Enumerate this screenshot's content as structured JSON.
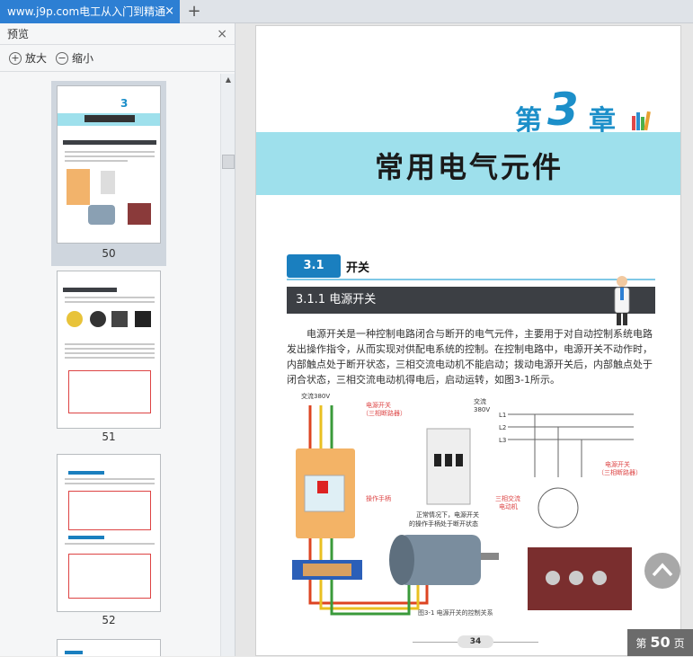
{
  "tab": {
    "title": "www.j9p.com电工从入门到精通",
    "new_tab": "+",
    "close": "×"
  },
  "sidebar": {
    "title": "预览",
    "close": "×",
    "zoom_in": "放大",
    "zoom_out": "缩小",
    "thumbnails": [
      {
        "page": "50",
        "selected": true
      },
      {
        "page": "51",
        "selected": false
      },
      {
        "page": "52",
        "selected": false
      }
    ]
  },
  "page": {
    "chapter_prefix": "第",
    "chapter_number": "3",
    "chapter_suffix": "章",
    "chapter_title": "常用电气元件",
    "section_number": "3.1",
    "section_title": "开关",
    "subsection": "3.1.1 电源开关",
    "paragraph": "电源开关是一种控制电路闭合与断开的电气元件，主要用于对自动控制系统电路发出操作指令，从而实现对供配电系统的控制。在控制电路中，电源开关不动作时，内部触点处于断开状态，三相交流电动机不能启动；拨动电源开关后，内部触点处于闭合状态，三相交流电动机得电后，启动运转，如图3-1所示。",
    "figure": {
      "label_ac380_left": "交流380V",
      "label_power_switch": "电源开关",
      "label_breaker": "（三相断路器）",
      "label_ac": "交流",
      "label_380v": "380V",
      "label_handle": "操作手柄",
      "label_note1": "正常情况下，电源开关",
      "label_note2": "的操作手柄处于断开状态",
      "label_motor1": "三相交流",
      "label_motor2": "电动机",
      "label_switch_r1": "电源开关",
      "label_switch_r2": "（三相断路器）",
      "l1": "L1",
      "l2": "L2",
      "l3": "L3",
      "caption": "图3-1  电源开关的控制关系"
    },
    "page_number": "34"
  },
  "page_indicator": {
    "prefix": "第",
    "number": "50",
    "suffix": "页"
  },
  "colors": {
    "tab_accent": "#2d7fd3",
    "chapter_blue": "#1c8fc9",
    "band_cyan": "#9ee0ec",
    "subbar": "#3c3f44"
  }
}
